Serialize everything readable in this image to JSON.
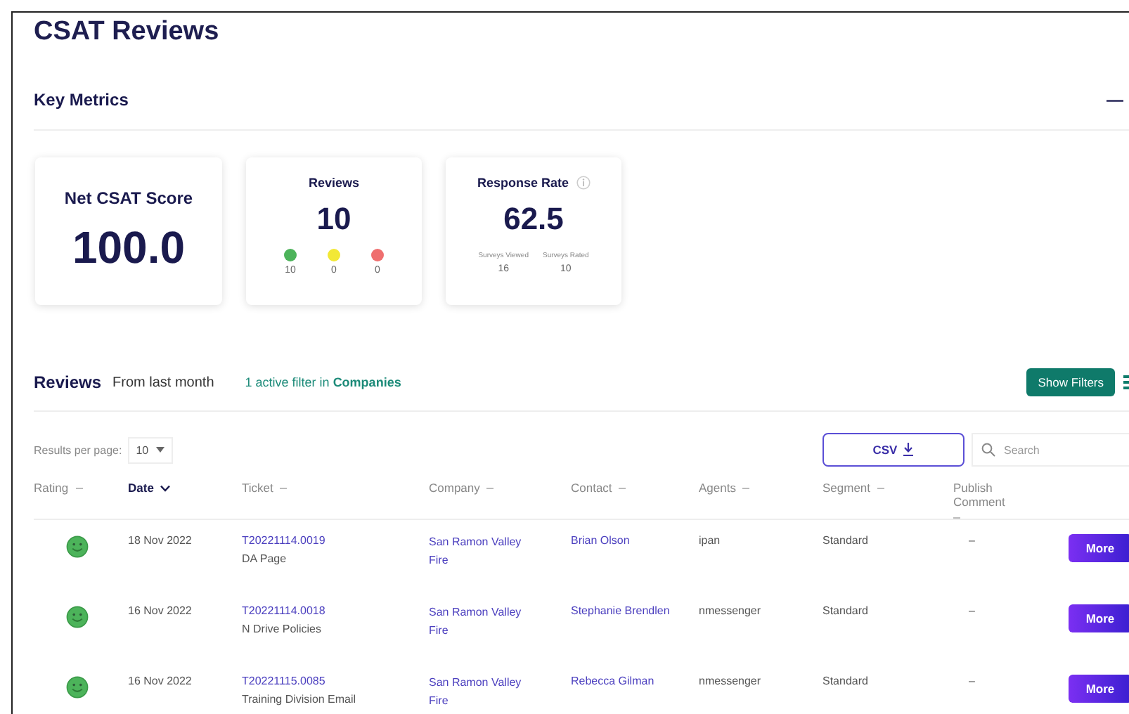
{
  "title": "CSAT Reviews",
  "key_metrics": {
    "title": "Key Metrics",
    "collapse_icon": "—"
  },
  "net_score": {
    "label": "Net CSAT Score",
    "value": "100.0"
  },
  "reviews_card": {
    "label": "Reviews",
    "value": "10",
    "breakdown": [
      {
        "count": "10",
        "color": "#4cb35a"
      },
      {
        "count": "0",
        "color": "#f2e835"
      },
      {
        "count": "0",
        "color": "#ef6f6f"
      }
    ]
  },
  "response_rate": {
    "label": "Response Rate",
    "value": "62.5",
    "stats": [
      {
        "label": "Surveys Viewed",
        "value": "16"
      },
      {
        "label": "Surveys Rated",
        "value": "10"
      }
    ]
  },
  "reviews": {
    "title": "Reviews",
    "period": "From last month",
    "filter_note": "1 active filter in **Companies**",
    "show_filters": "Show Filters"
  },
  "results_per_page": {
    "label": "Results per page:",
    "value": "10"
  },
  "csv_button": "CSV",
  "search": {
    "placeholder": "Search"
  },
  "columns": [
    {
      "label": "Rating",
      "sorted": false,
      "active": false
    },
    {
      "label": "Date",
      "sorted": true,
      "active": true
    },
    {
      "label": "Ticket",
      "sorted": false,
      "active": false
    },
    {
      "label": "Company",
      "sorted": false,
      "active": false
    },
    {
      "label": "Contact",
      "sorted": false,
      "active": false
    },
    {
      "label": "Agents",
      "sorted": false,
      "active": false
    },
    {
      "label": "Segment",
      "sorted": false,
      "active": false
    },
    {
      "label": "Publish Comment",
      "sorted": false,
      "active": false
    }
  ],
  "rows": [
    {
      "happy": true,
      "date": "18 Nov 2022",
      "ticket": "T20221114.0019",
      "subject": "DA Page",
      "company": "San Ramon Valley Fire",
      "contact": "Brian Olson",
      "agents": "ipan",
      "segment": "Standard",
      "publish_comment": "–",
      "action": "More"
    },
    {
      "happy": true,
      "date": "16 Nov 2022",
      "ticket": "T20221114.0018",
      "subject": "N Drive Policies",
      "company": "San Ramon Valley Fire",
      "contact": "Stephanie Brendlen",
      "agents": "nmessenger",
      "segment": "Standard",
      "publish_comment": "–",
      "action": "More"
    },
    {
      "happy": true,
      "date": "16 Nov 2022",
      "ticket": "T20221115.0085",
      "subject": "Training Division Email",
      "company": "San Ramon Valley Fire",
      "contact": "Rebecca Gilman",
      "agents": "nmessenger",
      "segment": "Standard",
      "publish_comment": "–",
      "action": "More"
    }
  ]
}
